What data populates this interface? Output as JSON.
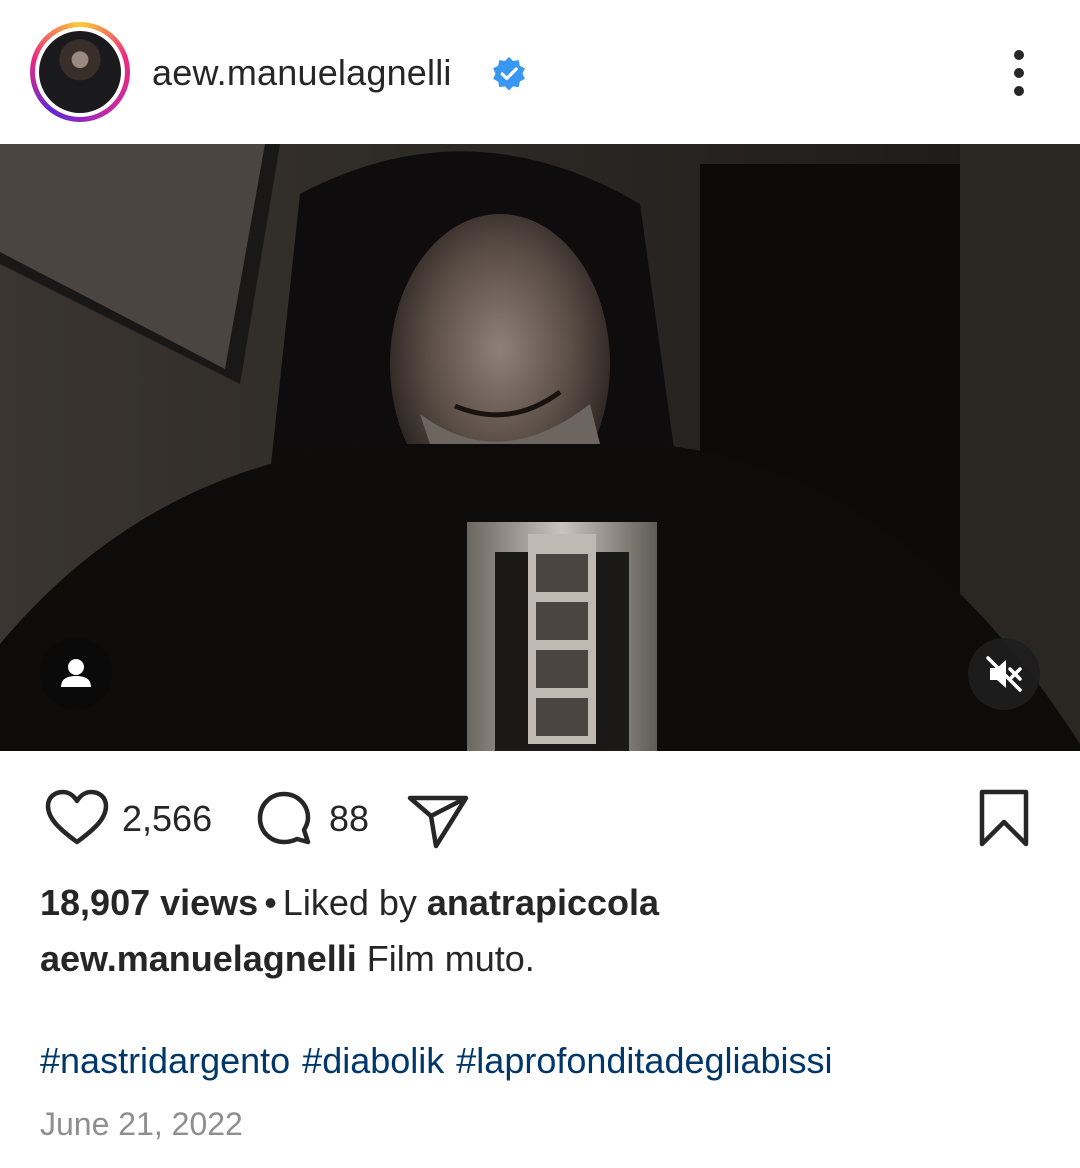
{
  "post": {
    "username": "aew.manuelagnelli",
    "verified": true,
    "likes": "2,566",
    "comments": "88",
    "views": "18,907 views",
    "separator": "•",
    "liked_by_prefix": "Liked by",
    "liked_by_user": "anatrapiccola",
    "caption_user": "aew.manuelagnelli",
    "caption_text": "Film muto.",
    "hashtags": [
      "#nastridargento",
      "#diabolik",
      "#laprofonditadegliabissi"
    ],
    "date": "June 21, 2022"
  },
  "icons": {
    "verified": "verified-badge-icon",
    "more": "more-options-icon",
    "user_tag": "user-tag-icon",
    "mute": "mute-icon",
    "like": "heart-icon",
    "comment": "comment-icon",
    "share": "share-icon",
    "save": "bookmark-icon"
  },
  "colors": {
    "verified_blue": "#3897f0",
    "hashtag_link": "#00376b",
    "muted_text": "#8e8e8e",
    "text": "#262626"
  }
}
